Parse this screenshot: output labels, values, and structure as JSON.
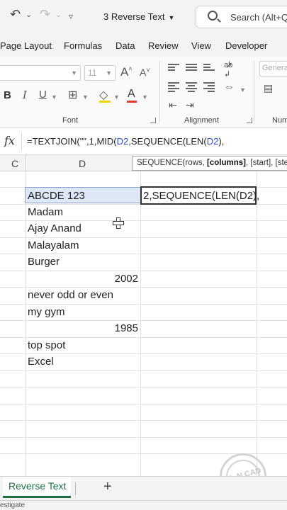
{
  "titlebar": {
    "undo_icon": "undo-icon",
    "redo_icon": "redo-icon",
    "customize_icon": "customize-quick-access-icon",
    "document_name": "3 Reverse Text",
    "search_placeholder": "Search (Alt+Q)"
  },
  "menu": {
    "items": [
      "Page Layout",
      "Formulas",
      "Data",
      "Review",
      "View",
      "Developer"
    ]
  },
  "ribbon": {
    "font_name": "",
    "font_size": "11",
    "bold_label": "B",
    "italic_label": "I",
    "underline_label": "U",
    "grow_font": "A",
    "shrink_font": "A",
    "group_font": "Font",
    "group_alignment": "Alignment",
    "group_number": "Num",
    "wrap_icon_text": "ab",
    "number_format": "Genera"
  },
  "formula_bar": {
    "fx_label": "fx",
    "formula_prefix": "=TEXTJOIN(\"\",1,MID(",
    "formula_ref1": "D2",
    "formula_mid": ",SEQUENCE(LEN(",
    "formula_ref2": "D2",
    "formula_suffix": "),"
  },
  "tooltip": {
    "prefix": "SEQUENCE(rows, ",
    "bold_arg": "[columns]",
    "suffix": ", [start], [step])"
  },
  "columns": {
    "c": "C",
    "d": "D"
  },
  "cells": {
    "d2": "ABCDE 123",
    "d3": "Madam",
    "d4": "Ajay Anand",
    "d5": "Malayalam",
    "d6": "Burger",
    "d7": "2002",
    "d8": "never odd or even",
    "d9": "my gym",
    "d10": "1985",
    "d11": "top spot",
    "d12": "Excel",
    "e2_editing": "2,SEQUENCE(LEN(D2),"
  },
  "watermark": {
    "text": "KL N CAD"
  },
  "sheets": {
    "active_tab": "Reverse Text",
    "add_symbol": "+"
  },
  "status": {
    "text": "estigate"
  }
}
